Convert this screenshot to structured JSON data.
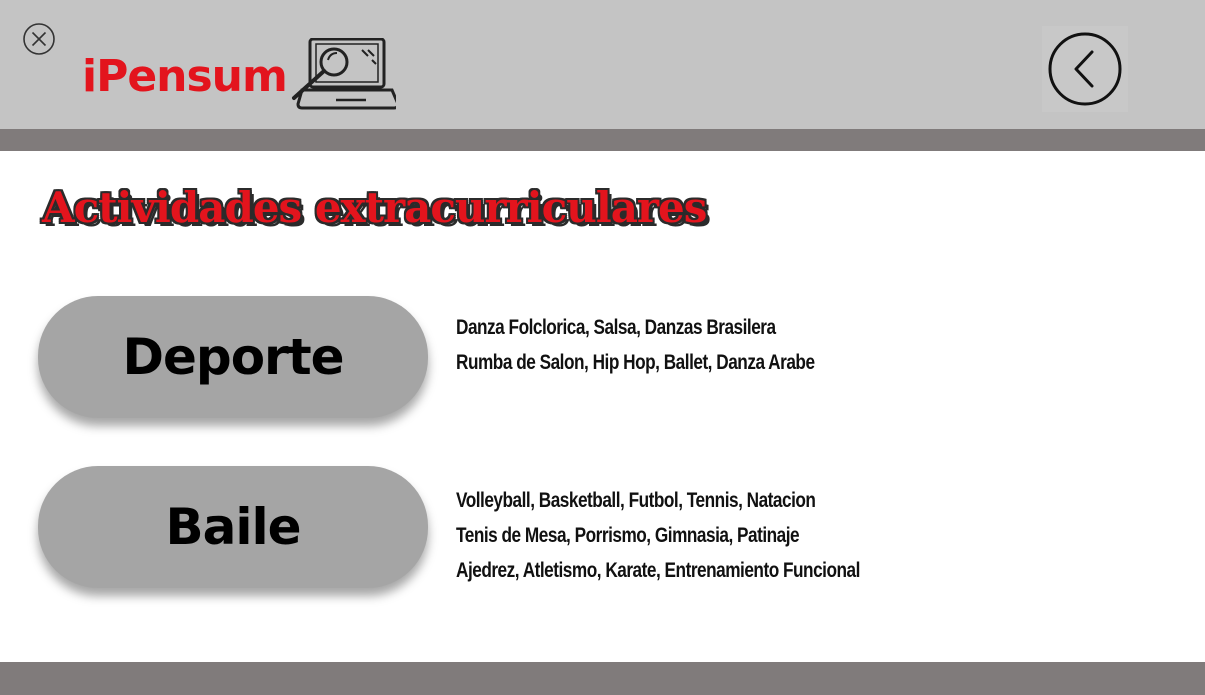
{
  "header": {
    "logo_text": "iPensum"
  },
  "page": {
    "title": "Actividades extracurriculares"
  },
  "buttons": [
    {
      "label": "Deporte",
      "description": [
        "Danza Folclorica, Salsa, Danzas Brasilera",
        "Rumba de Salon, Hip Hop, Ballet, Danza Arabe"
      ]
    },
    {
      "label": "Baile",
      "description": [
        "Volleyball, Basketball, Futbol, Tennis, Natacion",
        "Tenis de Mesa, Porrismo, Gimnasia, Patinaje",
        "Ajedrez, Atletismo, Karate, Entrenamiento Funcional"
      ]
    }
  ],
  "icons": {
    "close": "close-circle-icon",
    "logo": "laptop-magnifier-icon",
    "back": "chevron-left-circle-icon"
  },
  "colors": {
    "brand_red": "#e3141d",
    "header_bg": "#c4c4c4",
    "strip": "#807b7b",
    "button_bg": "#a5a5a5"
  }
}
